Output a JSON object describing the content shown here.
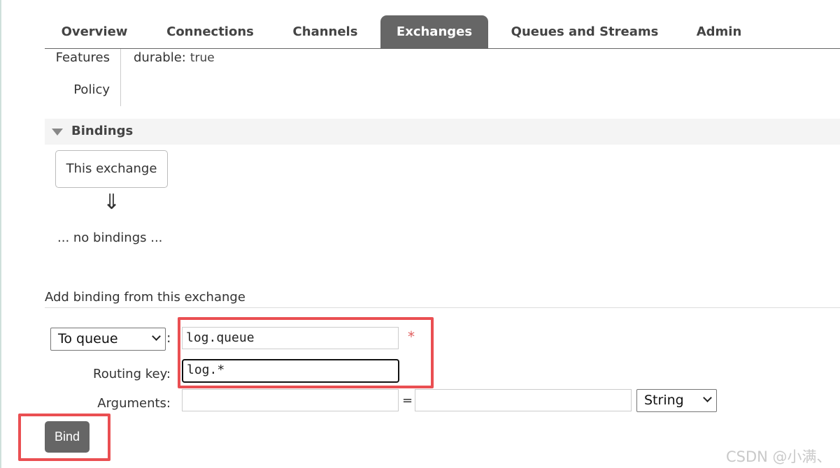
{
  "tabs": [
    {
      "label": "Overview"
    },
    {
      "label": "Connections"
    },
    {
      "label": "Channels"
    },
    {
      "label": "Exchanges"
    },
    {
      "label": "Queues and Streams"
    },
    {
      "label": "Admin"
    }
  ],
  "active_tab": "Exchanges",
  "details": {
    "features_label": "Features",
    "policy_label": "Policy",
    "durable_key": "durable:",
    "durable_value": "true"
  },
  "bindings": {
    "title": "Bindings",
    "this_exchange": "This exchange",
    "arrow": "⇓",
    "empty_text": "... no bindings ..."
  },
  "add_binding": {
    "title": "Add binding from this exchange",
    "destination_type": "To queue",
    "destination_value": "log.queue",
    "required_marker": "*",
    "routing_key_label": "Routing key:",
    "routing_key_value": "log.*",
    "arguments_label": "Arguments:",
    "argument_key": "",
    "argument_equals": "=",
    "argument_value": "",
    "argument_type": "String",
    "bind_button": "Bind"
  },
  "watermark": "CSDN @小满、",
  "colors": {
    "active_tab_bg": "#666666",
    "highlight": "#ea4f52",
    "required": "#e06060"
  }
}
